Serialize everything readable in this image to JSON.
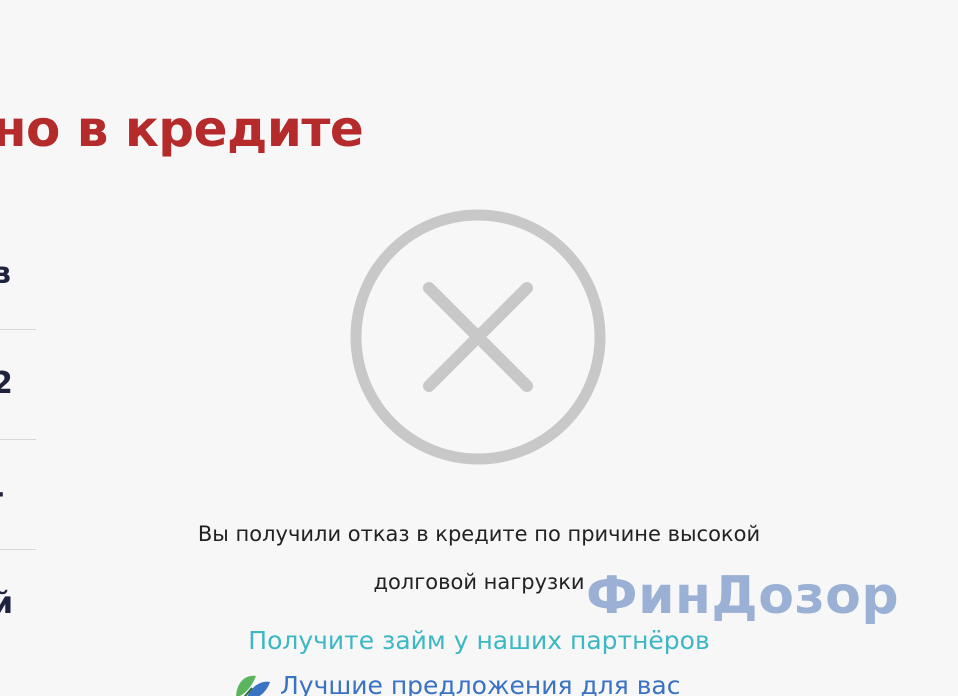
{
  "heading": "но в кредите",
  "left_items": [
    "в",
    "2",
    "-",
    "й"
  ],
  "error_icon": "close-circle-icon",
  "message": {
    "line1": "Вы получили отказ в кредите по причине высокой",
    "line2": "долговой нагрузки"
  },
  "watermark": "ФинДозор",
  "cta": {
    "partners_link": "Получите займ у наших партнёров",
    "offers_link": "Лучшие предложения для вас"
  },
  "colors": {
    "heading": "#b52a2a",
    "icon": "#c8c8c8",
    "partners_link": "#3cb7c4",
    "offers_link": "#3a72c4",
    "watermark": "#8aa4cf"
  }
}
